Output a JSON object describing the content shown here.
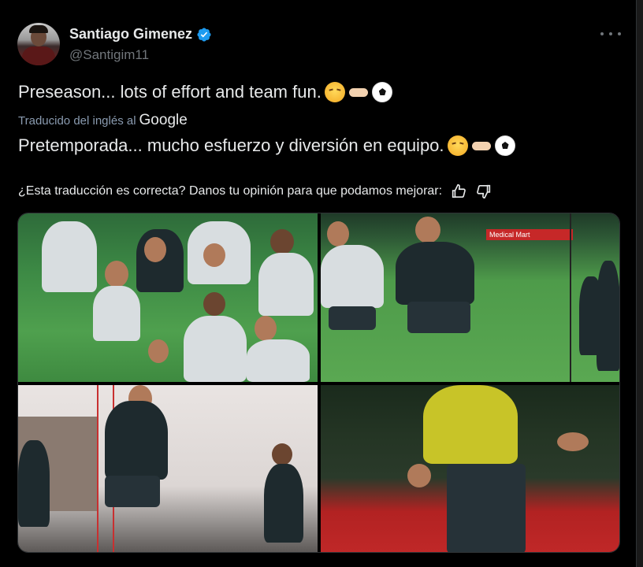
{
  "author": {
    "display_name": "Santiago Gimenez",
    "handle": "@Santigim11",
    "verified": true
  },
  "tweet": {
    "text": "Preseason... lots of effort and team fun.",
    "emojis": [
      "steam-face-emoji",
      "handshake-emoji",
      "soccer-ball-emoji"
    ]
  },
  "translation": {
    "label": "Traducido del inglés al",
    "provider": "Google",
    "text": "Pretemporada... mucho esfuerzo y diversión en equipo."
  },
  "feedback": {
    "question": "¿Esta traducción es correcta? Danos tu opinión para que podamos mejorar:"
  },
  "media": {
    "banner_text": "Medical Mart"
  },
  "colors": {
    "background": "#000000",
    "text": "#e7e9ea",
    "secondary": "#71767b",
    "verified": "#1d9bf0",
    "translated_label": "#8a9bb0"
  }
}
